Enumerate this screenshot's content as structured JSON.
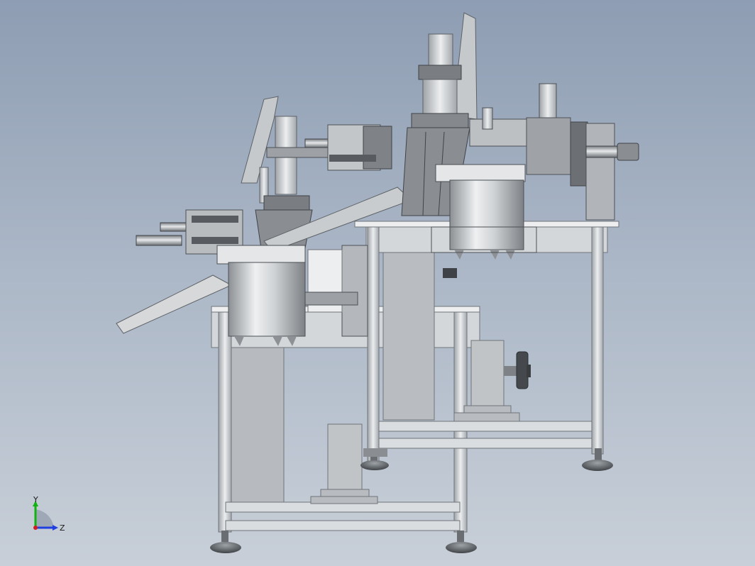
{
  "triad": {
    "y_label": "Y",
    "z_label": "Z",
    "y_color": "#11b311",
    "z_color": "#1f3fe0",
    "origin_color": "#d11d1d"
  },
  "colors": {
    "background_top": "#8e9db3",
    "background_bottom": "#c8cfd8",
    "frame": "#d9dcdf",
    "frame_shadow": "#8f959b",
    "cylinder": "#c9cccf",
    "steel_dark": "#565b60",
    "panel": "#a9adb1",
    "mount": "#b8bbb3"
  }
}
